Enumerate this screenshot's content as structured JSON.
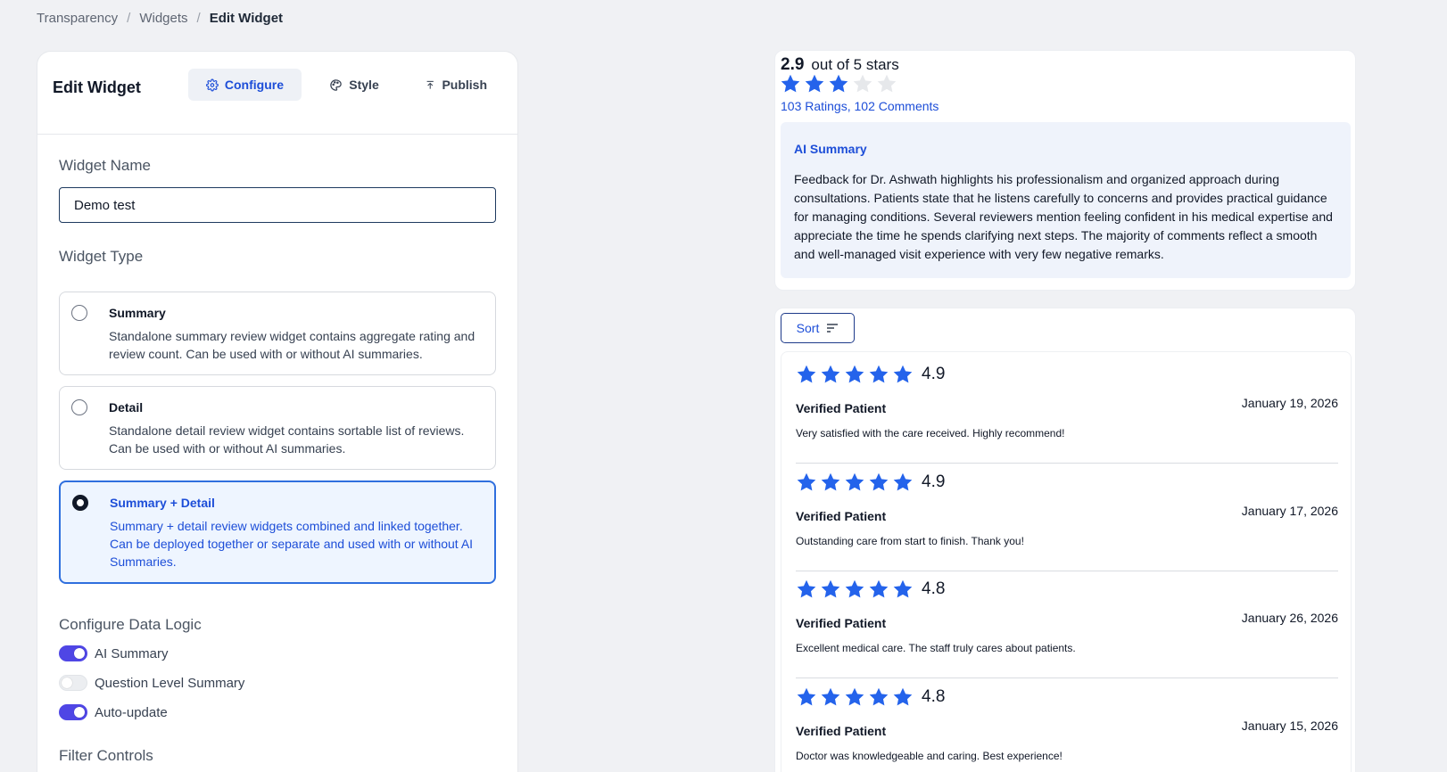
{
  "breadcrumb": {
    "items": [
      "Transparency",
      "Widgets"
    ],
    "current": "Edit Widget"
  },
  "editor": {
    "title": "Edit Widget",
    "tabs": [
      {
        "label": "Configure",
        "icon": "gear-icon",
        "active": true
      },
      {
        "label": "Style",
        "icon": "palette-icon",
        "active": false
      },
      {
        "label": "Publish",
        "icon": "upload-icon",
        "active": false
      }
    ],
    "widget_name_label": "Widget Name",
    "widget_name_value": "Demo test",
    "widget_type_label": "Widget Type",
    "widget_types": [
      {
        "title": "Summary",
        "desc": "Standalone summary review widget contains aggregate rating and review count. Can be used with or without AI summaries.",
        "selected": false
      },
      {
        "title": "Detail",
        "desc": "Standalone detail review widget contains sortable list of reviews. Can be used with or without AI summaries.",
        "selected": false
      },
      {
        "title": "Summary + Detail",
        "desc": "Summary + detail review widgets combined and linked together. Can be deployed together or separate and used with or without AI Summaries.",
        "selected": true
      }
    ],
    "data_logic_label": "Configure Data Logic",
    "toggles": [
      {
        "label": "AI Summary",
        "on": true
      },
      {
        "label": "Question Level Summary",
        "on": false
      },
      {
        "label": "Auto-update",
        "on": true
      }
    ],
    "filter_controls_label": "Filter Controls"
  },
  "summary": {
    "rating": "2.9",
    "rating_suffix": "out of 5 stars",
    "stars_filled": 3,
    "stars_total": 5,
    "counts_link": "103 Ratings, 102 Comments",
    "ai_title": "AI Summary",
    "ai_text": "Feedback for Dr. Ashwath highlights his professionalism and organized approach during consultations. Patients state that he listens carefully to concerns and provides practical guidance for managing conditions. Several reviewers mention feeling confident in his medical expertise and appreciate the time he spends clarifying next steps. The majority of comments reflect a smooth and well-managed visit experience with very few negative remarks."
  },
  "detail": {
    "sort_label": "Sort",
    "reviews": [
      {
        "score": "4.9",
        "author": "Verified Patient",
        "date": "January 19, 2026",
        "text": "Very satisfied with the care received. Highly recommend!",
        "stars": 5
      },
      {
        "score": "4.9",
        "author": "Verified Patient",
        "date": "January 17, 2026",
        "text": "Outstanding care from start to finish. Thank you!",
        "stars": 5
      },
      {
        "score": "4.8",
        "author": "Verified Patient",
        "date": "January 26, 2026",
        "text": "Excellent medical care. The staff truly cares about patients.",
        "stars": 5
      },
      {
        "score": "4.8",
        "author": "Verified Patient",
        "date": "January 15, 2026",
        "text": "Doctor was knowledgeable and caring. Best experience!",
        "stars": 5
      }
    ]
  },
  "colors": {
    "accent": "#1d4ed8",
    "star": "#2463eb",
    "toggle_on": "#4f46e5"
  }
}
